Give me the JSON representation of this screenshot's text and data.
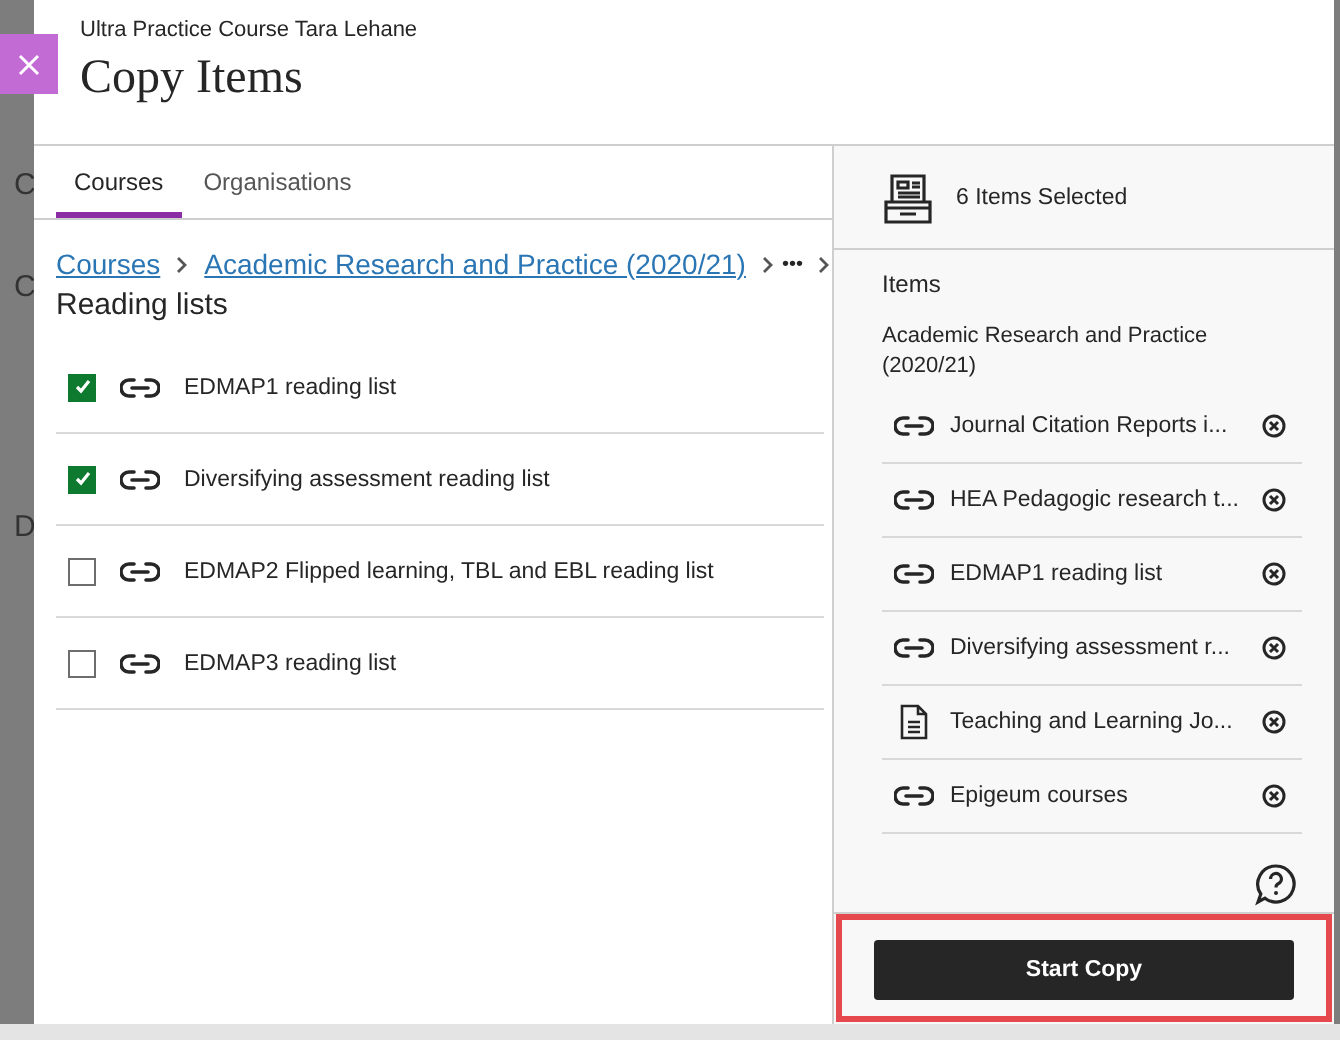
{
  "backdrop": {
    "texts": [
      "C",
      "C",
      "D"
    ]
  },
  "header": {
    "course": "Ultra Practice Course Tara Lehane",
    "title": "Copy Items"
  },
  "tabs": [
    {
      "label": "Courses",
      "selected": true
    },
    {
      "label": "Organisations",
      "selected": false
    }
  ],
  "breadcrumb": {
    "links": [
      "Courses",
      "Academic Research and Practice (2020/21)"
    ],
    "more": "•••",
    "current": "Reading lists"
  },
  "items": [
    {
      "label": "EDMAP1 reading list",
      "checked": true,
      "kind": "link"
    },
    {
      "label": "Diversifying assessment reading list",
      "checked": true,
      "kind": "link"
    },
    {
      "label": "EDMAP2 Flipped learning, TBL and EBL reading list",
      "checked": false,
      "kind": "link"
    },
    {
      "label": "EDMAP3 reading list",
      "checked": false,
      "kind": "link"
    }
  ],
  "summary": {
    "count": "6 Items Selected",
    "heading": "Items",
    "course": "Academic Research and Practice (2020/21)",
    "items": [
      {
        "label": "Journal Citation Reports i...",
        "kind": "link"
      },
      {
        "label": "HEA Pedagogic research t...",
        "kind": "link"
      },
      {
        "label": "EDMAP1 reading list",
        "kind": "link"
      },
      {
        "label": "Diversifying assessment r...",
        "kind": "link"
      },
      {
        "label": "Teaching and Learning Jo...",
        "kind": "document"
      },
      {
        "label": "Epigeum courses",
        "kind": "link"
      }
    ]
  },
  "start_button": {
    "label": "Start Copy",
    "highlighted": true
  }
}
